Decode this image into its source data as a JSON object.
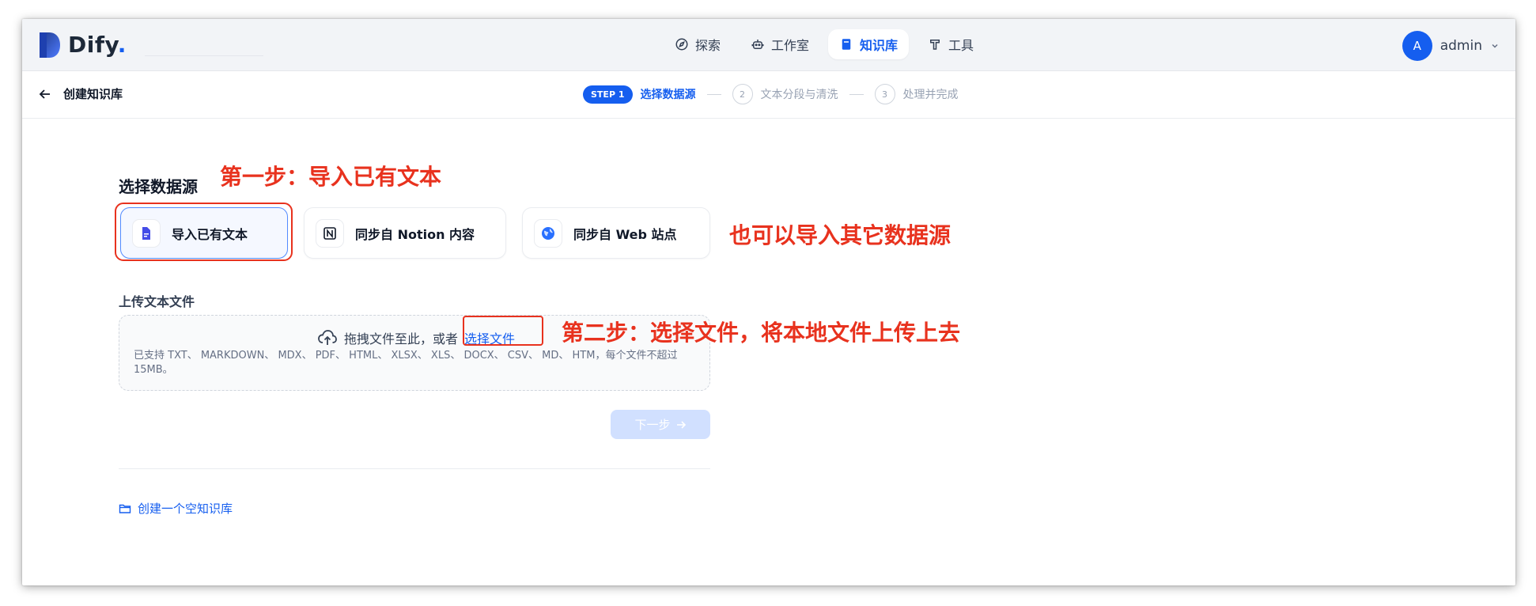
{
  "app": {
    "name": "Dify",
    "dot": "."
  },
  "nav": {
    "items": [
      {
        "label": "探索",
        "icon": "compass-icon"
      },
      {
        "label": "工作室",
        "icon": "robot-icon"
      },
      {
        "label": "知识库",
        "icon": "book-icon",
        "active": true
      },
      {
        "label": "工具",
        "icon": "hammer-icon"
      }
    ]
  },
  "user": {
    "initial": "A",
    "name": "admin"
  },
  "header": {
    "back_title": "创建知识库",
    "steps": {
      "active_badge": "STEP 1",
      "active_label": "选择数据源",
      "step2_num": "2",
      "step2_label": "文本分段与清洗",
      "step3_num": "3",
      "step3_label": "处理并完成"
    }
  },
  "main": {
    "section_title": "选择数据源",
    "sources": [
      {
        "label": "导入已有文本",
        "icon": "document-icon",
        "active": true
      },
      {
        "label": "同步自 Notion 内容",
        "icon": "notion-icon"
      },
      {
        "label": "同步自 Web 站点",
        "icon": "globe-icon"
      }
    ],
    "upload_label": "上传文本文件",
    "dropzone": {
      "text": "拖拽文件至此，或者",
      "link": "选择文件",
      "hint": "已支持 TXT、 MARKDOWN、 MDX、 PDF、 HTML、 XLSX、 XLS、 DOCX、 CSV、 MD、 HTM，每个文件不超过 15MB。"
    },
    "next_button": "下一步",
    "empty_link": "创建一个空知识库"
  },
  "annotations": {
    "step1": "第一步：导入已有文本",
    "other_sources": "也可以导入其它数据源",
    "step2": "第二步：选择文件，将本地文件上传上去"
  },
  "colors": {
    "accent": "#155eef",
    "annotation": "#e8321e"
  }
}
